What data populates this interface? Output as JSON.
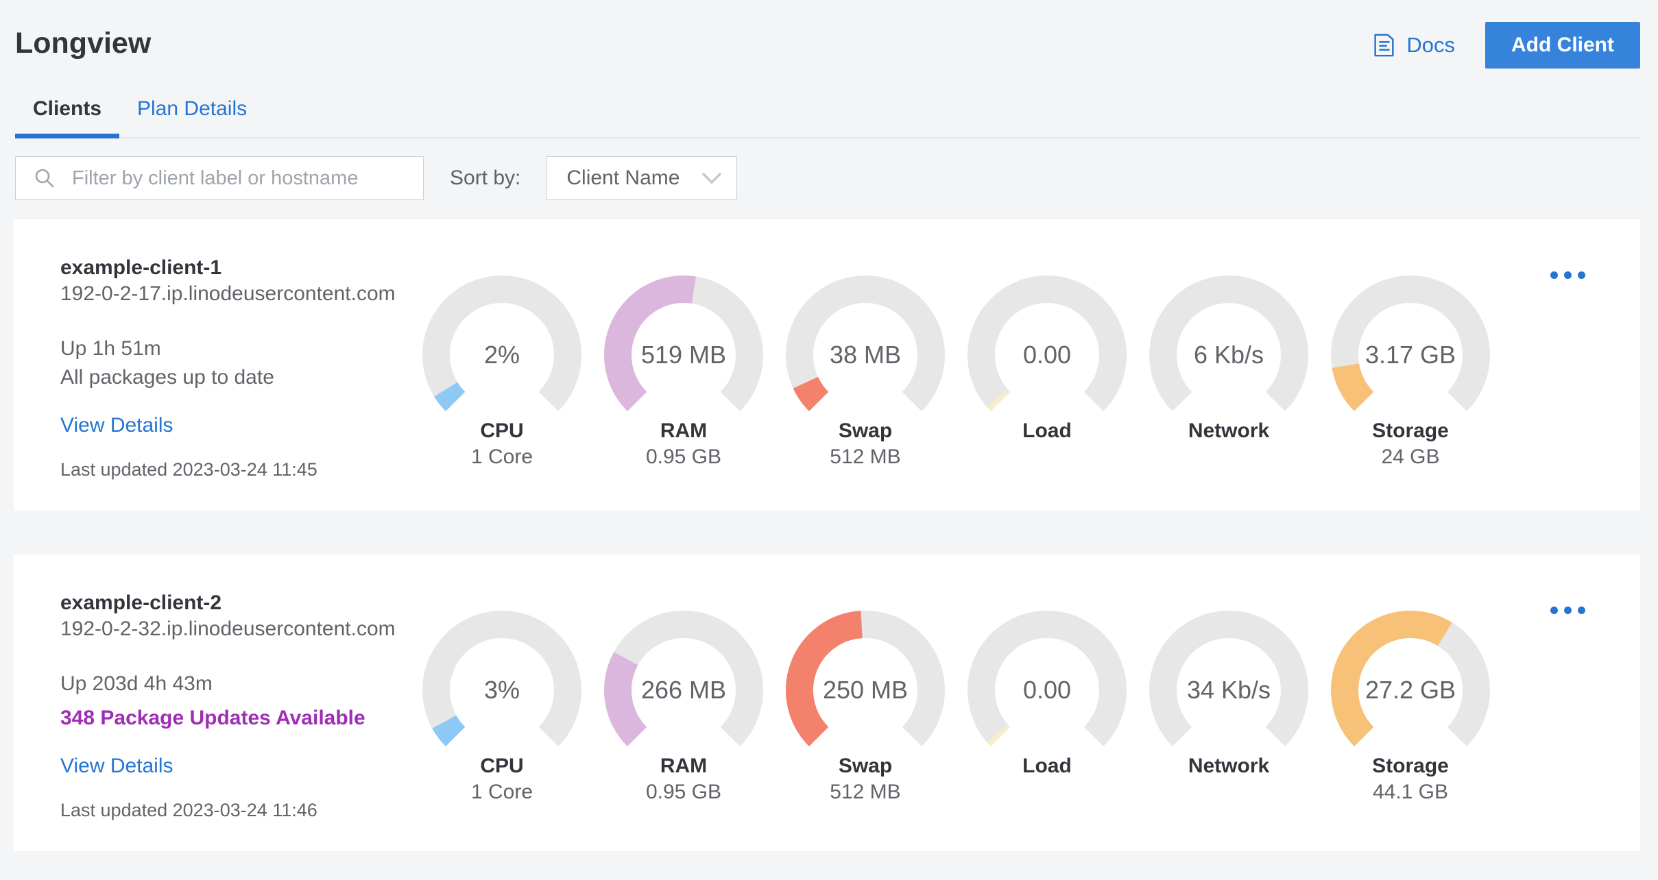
{
  "header": {
    "title": "Longview",
    "docs_label": "Docs",
    "add_client_label": "Add Client"
  },
  "tabs": [
    {
      "label": "Clients",
      "active": true
    },
    {
      "label": "Plan Details",
      "active": false
    }
  ],
  "filter": {
    "placeholder": "Filter by client label or hostname",
    "sort_label": "Sort by:",
    "sort_value": "Client Name"
  },
  "colors": {
    "accent_blue": "#3683dc",
    "link_blue": "#2575d0",
    "text_dark": "#32363c",
    "text_gray": "#606469",
    "warning_purple": "#9e2fb5",
    "gauge_track": "#e7e7e7",
    "gauge_cpu_blue": "#8ec8f4",
    "gauge_ram_purple": "#dbb7de",
    "gauge_swap_salmon": "#f4816c",
    "gauge_load_yellow": "#f5eecb",
    "gauge_storage_orange": "#f7c178"
  },
  "clients": [
    {
      "name": "example-client-1",
      "hostname": "192-0-2-17.ip.linodeusercontent.com",
      "uptime": "Up 1h 51m",
      "packages": "All packages up to date",
      "packages_alert": false,
      "view_details_label": "View Details",
      "last_updated": "Last updated 2023-03-24 11:45",
      "gauges": [
        {
          "label": "CPU",
          "value": "2%",
          "sublabel": "1 Core",
          "fraction": 0.05,
          "color": "#8ec8f4"
        },
        {
          "label": "RAM",
          "value": "519 MB",
          "sublabel": "0.95 GB",
          "fraction": 0.533,
          "color": "#dbb7de"
        },
        {
          "label": "Swap",
          "value": "38 MB",
          "sublabel": "512 MB",
          "fraction": 0.075,
          "color": "#f4816c"
        },
        {
          "label": "Load",
          "value": "0.00",
          "sublabel": "",
          "fraction": 0.015,
          "color": "#f5eecb"
        },
        {
          "label": "Network",
          "value": "6 Kb/s",
          "sublabel": "",
          "fraction": 0,
          "color": "#8ec8f4"
        },
        {
          "label": "Storage",
          "value": "3.17 GB",
          "sublabel": "24 GB",
          "fraction": 0.132,
          "color": "#f7c178"
        }
      ]
    },
    {
      "name": "example-client-2",
      "hostname": "192-0-2-32.ip.linodeusercontent.com",
      "uptime": "Up 203d 4h 43m",
      "packages": "348 Package Updates Available",
      "packages_alert": true,
      "view_details_label": "View Details",
      "last_updated": "Last updated 2023-03-24 11:46",
      "gauges": [
        {
          "label": "CPU",
          "value": "3%",
          "sublabel": "1 Core",
          "fraction": 0.06,
          "color": "#8ec8f4"
        },
        {
          "label": "RAM",
          "value": "266 MB",
          "sublabel": "0.95 GB",
          "fraction": 0.273,
          "color": "#dbb7de"
        },
        {
          "label": "Swap",
          "value": "250 MB",
          "sublabel": "512 MB",
          "fraction": 0.488,
          "color": "#f4816c"
        },
        {
          "label": "Load",
          "value": "0.00",
          "sublabel": "",
          "fraction": 0.015,
          "color": "#f5eecb"
        },
        {
          "label": "Network",
          "value": "34 Kb/s",
          "sublabel": "",
          "fraction": 0,
          "color": "#8ec8f4"
        },
        {
          "label": "Storage",
          "value": "27.2 GB",
          "sublabel": "44.1 GB",
          "fraction": 0.617,
          "color": "#f7c178"
        }
      ]
    }
  ]
}
